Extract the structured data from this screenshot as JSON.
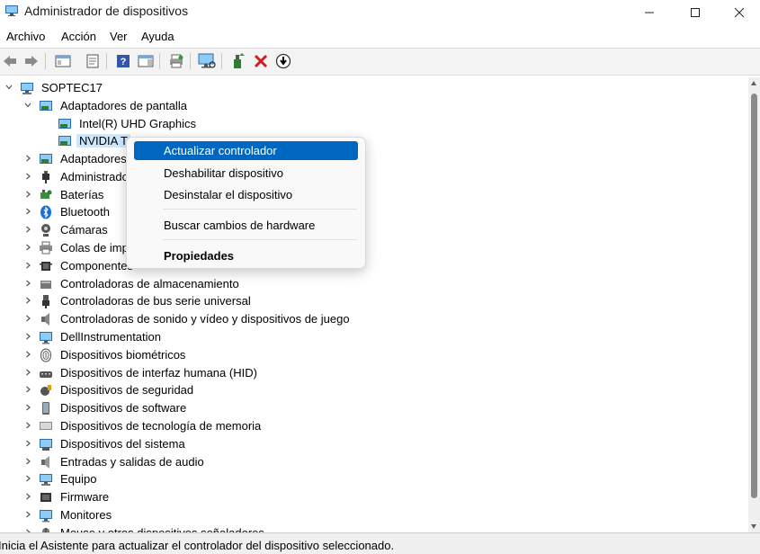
{
  "window": {
    "title": "Administrador de dispositivos"
  },
  "menubar": [
    "Archivo",
    "Acción",
    "Ver",
    "Ayuda"
  ],
  "toolbar": [
    "back-icon",
    "forward-icon",
    "show-hide-console-tree-icon",
    "properties-icon",
    "help-icon",
    "action-pane-icon",
    "update-driver-icon",
    "scan-hardware-icon",
    "enable-device-icon",
    "uninstall-icon",
    "download-icon"
  ],
  "tree": {
    "root": "SOPTEC17",
    "display_adapters": "Adaptadores de pantalla",
    "display_children": [
      "Intel(R) UHD Graphics",
      "NVIDIA T"
    ],
    "categories": [
      "Adaptadores",
      "Administrado",
      "Baterías",
      "Bluetooth",
      "Cámaras",
      "Colas de imp",
      "Componentes",
      "Controladoras de almacenamiento",
      "Controladoras de bus serie universal",
      "Controladoras de sonido y vídeo y dispositivos de juego",
      "DellInstrumentation",
      "Dispositivos biométricos",
      "Dispositivos de interfaz humana (HID)",
      "Dispositivos de seguridad",
      "Dispositivos de software",
      "Dispositivos de tecnología de memoria",
      "Dispositivos del sistema",
      "Entradas y salidas de audio",
      "Equipo",
      "Firmware",
      "Monitores",
      "Mouse y otros dispositivos señaladores"
    ]
  },
  "context_menu": {
    "items": [
      "Actualizar controlador",
      "Deshabilitar dispositivo",
      "Desinstalar el dispositivo",
      "Buscar cambios de hardware",
      "Propiedades"
    ]
  },
  "status": {
    "text": "Inicia el Asistente para actualizar el controlador del dispositivo seleccionado."
  },
  "colors": {
    "accent": "#0067c0",
    "selection": "#cce8ff"
  }
}
